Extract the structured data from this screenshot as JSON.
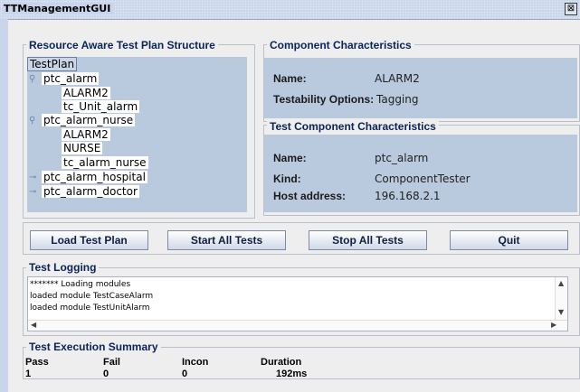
{
  "window": {
    "title": "TTManagementGUI",
    "close_glyph": "⊠"
  },
  "structure_panel": {
    "title": "Resource Aware Test Plan Structure",
    "tree": {
      "root": "TestPlan",
      "nodes": [
        {
          "label": "ptc_alarm",
          "icon": "open-key-icon"
        },
        {
          "label": "ALARM2"
        },
        {
          "label": "tc_Unit_alarm"
        },
        {
          "label": "ptc_alarm_nurse",
          "icon": "open-key-icon"
        },
        {
          "label": "ALARM2"
        },
        {
          "label": "NURSE"
        },
        {
          "label": "tc_alarm_nurse"
        },
        {
          "label": "ptc_alarm_hospital",
          "icon": "closed-key-icon"
        },
        {
          "label": "ptc_alarm_doctor",
          "icon": "closed-key-icon"
        }
      ]
    }
  },
  "component": {
    "title": "Component Characteristics",
    "name_label": "Name:",
    "name_value": "ALARM2",
    "testability_label": "Testability Options:",
    "testability_value": "Tagging"
  },
  "test_component": {
    "title": "Test Component Characteristics",
    "name_label": "Name:",
    "name_value": "ptc_alarm",
    "kind_label": "Kind:",
    "kind_value": "ComponentTester",
    "host_label": "Host address:",
    "host_value": "196.168.2.1"
  },
  "buttons": {
    "load": "Load Test Plan",
    "start": "Start All Tests",
    "stop": "Stop All Tests",
    "quit": "Quit"
  },
  "logging": {
    "title": "Test Logging",
    "lines": [
      "******* Loading modules",
      "loaded module TestCaseAlarm",
      "loaded module TestUnitAlarm"
    ]
  },
  "summary": {
    "title": "Test Execution Summary",
    "headers": [
      "Pass",
      "Fail",
      "Incon",
      "Duration"
    ],
    "values": [
      "1",
      "0",
      "0",
      "192ms"
    ]
  },
  "colors": {
    "accent": "#0a2458",
    "tree_bg": "#b9c9de",
    "titlebar": "#c9d5ea"
  }
}
